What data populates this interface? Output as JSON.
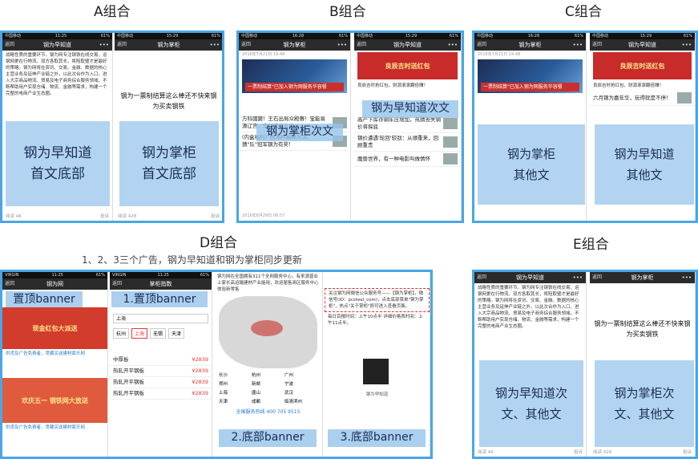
{
  "groups": {
    "a": {
      "title": "A组合"
    },
    "b": {
      "title": "B组合"
    },
    "c": {
      "title": "C组合"
    },
    "d": {
      "title": "D组合",
      "subtitle": "1、2、3三个广告，钢为早知道和钢为掌柜同步更新"
    },
    "e": {
      "title": "E组合"
    }
  },
  "phones": {
    "zhidao_nav": "钢为早知道",
    "zhanggui_nav": "钢为掌柜",
    "back": "返回",
    "close": "关闭",
    "dots": "•••",
    "carrier": "中国移动",
    "time_a": "11:25",
    "time_b": "15:29",
    "time_c": "16:28",
    "battery": "61%",
    "wang_nav": "钢为网",
    "zhishu_nav": "掌柜指数",
    "virgin": "VIRGIN"
  },
  "content": {
    "zhidao_text": "战略性质的重要环节。钢为网专注钢铁在线交易、运钢网更在行物流、双方各取其长，将阻取璧才是最好的策略。钢为网将在资讯、交易、金融、数据的核心主营业务及延伸产业链之外，以此次合作为入口，进入大宗商品物流、贸易及电子商务综合服务领域，不断帮助用户实现仓储、物流、金融等需求，构建一个完整的电商产业生态圈。",
    "zhanggui_text": "钢为一票制结算这么棒还不快来钢为买卖钢铁",
    "footer_read": "阅读 46",
    "footer_read2": "阅读 428",
    "footer_like": "5",
    "footer_report": "投诉",
    "date_b": "2016年7月21日 19:48",
    "date_b2": "2016年6月29日 06:57",
    "banner_caption": "一票制结算\"已加入钢为网服务华容餐",
    "red_ad": "良辰吉时送红包",
    "red_ad_sub": "良辰吉时抢红包，财源滚滚翻倍赚！",
    "news": [
      "万科國變！王石出局众殿赛！宝能易源辽宫，华润董亭五座",
      "(内盒福利）欧洲杯巅峰对决，猜\"队\"冠军钢为有奖！",
      "高产下库存钢年压增加，热猜丧失钢价将探底",
      "钢价遭遇'轮回'较劲：从顺重来，回顾重贵",
      "魔兽世界，有一种电影叫做情怀"
    ],
    "c_news": "六月钢为嘉年华，玩得就是不停！",
    "qr_caption": "钢为早知道"
  },
  "labels": {
    "a1": "钢为早知道首文底部",
    "a2": "钢为掌柜首文底部",
    "b1": "钢为早知道次文",
    "b2": "钢为掌柜次文",
    "c1": "钢为掌柜其他文",
    "c2": "钢为早知道其他文",
    "d1": "置顶banner",
    "d2": "1.置顶banner",
    "d3": "2.底部banner",
    "d4": "3.底部banner",
    "e1": "钢为早知道次文、其他文",
    "e2": "钢为掌柜次文、其他文"
  },
  "d_content": {
    "cash_ad": "现金红包大派送",
    "holiday_ad": "欢庆五一 钢铁网大放送",
    "ad_caption": "供货及广告免费者，竞藏买送建材家乐网",
    "search_city": "上海",
    "cities": [
      "杭州",
      "上海",
      "无锡",
      "天津"
    ],
    "price_rows": [
      {
        "name": "中厚板",
        "price": "¥2839"
      },
      {
        "name": "热轧开平钢板",
        "price": "¥2839"
      },
      {
        "name": "热轧开平钢板",
        "price": "¥2839"
      },
      {
        "name": "热轧开平钢板",
        "price": "¥2839"
      }
    ],
    "map_intro": "钢为网在全国拥有311个全网服务中心，有来源普业上家长高运输建材产业能用，欢迎届售商区服务中心体验新零售",
    "map_cities": [
      "长沙",
      "杭州",
      "广州",
      "郑州",
      "新邮",
      "宁波",
      "上海",
      "唐山",
      "武汉",
      "天津",
      "成都",
      "临清滨州"
    ],
    "hotline": "全国服务热线 400 705 9515",
    "qr_text": "关注钢为网微信公众服务号——【钢为掌柜】，微信号(ID：pcsteel_com)，点击底部菜单\"钢为掌柜\"，热点\"关于掌柜\"即可进入查看页面。",
    "schedule": "每日百报时间：上午10点半 详细价格表时间：上午11点半。"
  },
  "colors": {
    "frame": "#4aa6e6",
    "overlay": "#96c3eb",
    "ad_red": "#c82b2a"
  }
}
